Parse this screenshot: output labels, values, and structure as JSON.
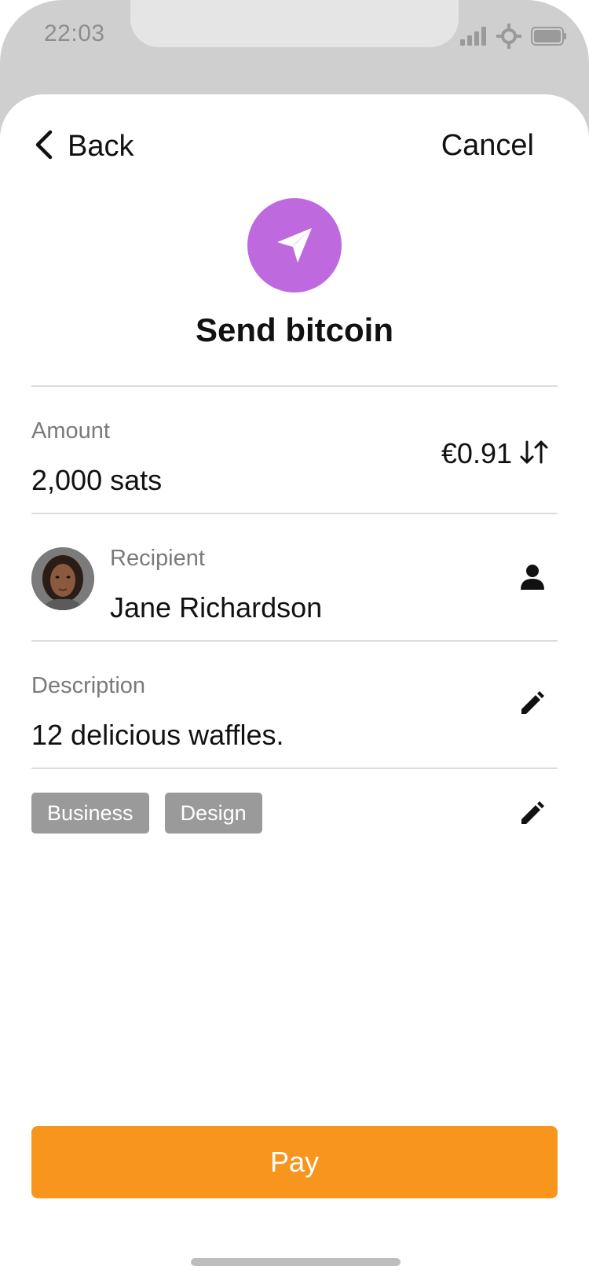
{
  "status_bar": {
    "time": "22:03",
    "icons": [
      "signal-icon",
      "network-icon",
      "battery-icon"
    ]
  },
  "nav": {
    "back_label": "Back",
    "cancel_label": "Cancel"
  },
  "header": {
    "icon": "send-icon",
    "title": "Send bitcoin",
    "icon_color": "#be6ade"
  },
  "amount": {
    "label": "Amount",
    "value": "2,000 sats",
    "fiat_value": "€0.91",
    "swap_icon": "swap-arrows-icon"
  },
  "recipient": {
    "label": "Recipient",
    "name": "Jane Richardson",
    "icon": "contact-icon"
  },
  "description": {
    "label": "Description",
    "value": "12 delicious waffles.",
    "icon": "edit-icon"
  },
  "tags": {
    "items": [
      "Business",
      "Design"
    ],
    "icon": "edit-icon"
  },
  "pay_button": {
    "label": "Pay",
    "color": "#f7951d"
  }
}
